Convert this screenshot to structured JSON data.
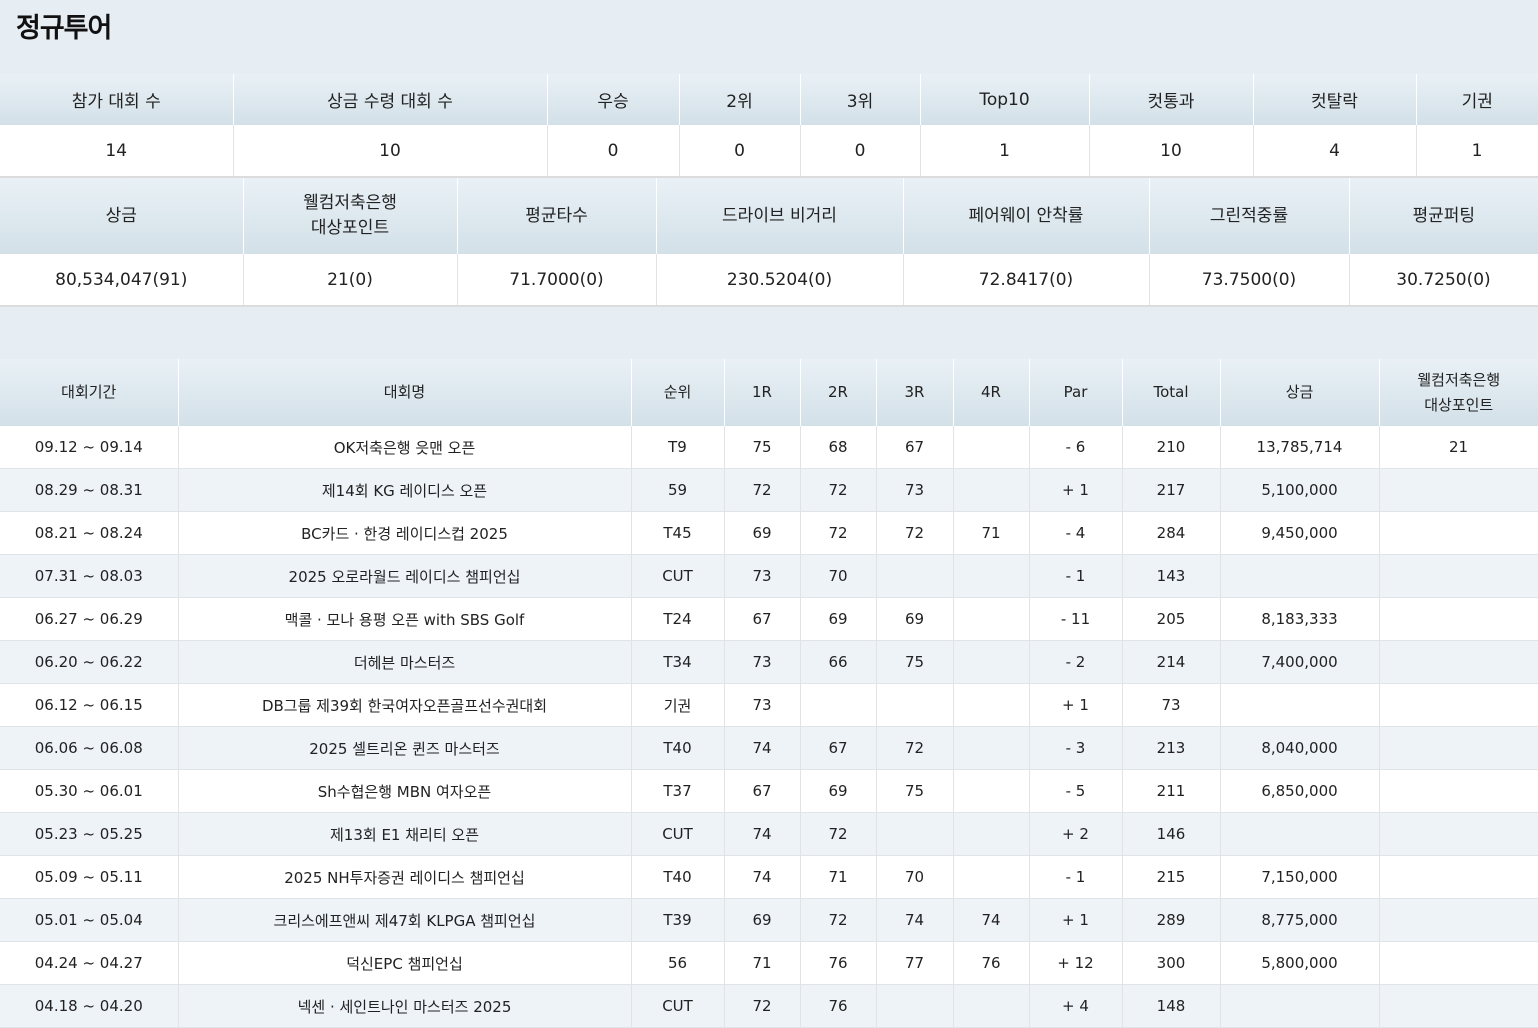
{
  "page_title": "정규투어",
  "summary": {
    "headers": [
      "참가 대회 수",
      "상금 수령 대회 수",
      "우승",
      "2위",
      "3위",
      "Top10",
      "컷통과",
      "컷탈락",
      "기권"
    ],
    "values": [
      "14",
      "10",
      "0",
      "0",
      "0",
      "1",
      "10",
      "4",
      "1"
    ]
  },
  "stats": {
    "headers": [
      "상금",
      "웰컴저축은행\n대상포인트",
      "평균타수",
      "드라이브 비거리",
      "페어웨이 안착률",
      "그린적중률",
      "평균퍼팅"
    ],
    "values": [
      "80,534,047(91)",
      "21(0)",
      "71.7000(0)",
      "230.5204(0)",
      "72.8417(0)",
      "73.7500(0)",
      "30.7250(0)"
    ]
  },
  "results": {
    "headers": [
      "대회기간",
      "대회명",
      "순위",
      "1R",
      "2R",
      "3R",
      "4R",
      "Par",
      "Total",
      "상금",
      "웰컴저축은행\n대상포인트"
    ],
    "rows": [
      [
        "09.12 ~ 09.14",
        "OK저축은행 읏맨 오픈",
        "T9",
        "75",
        "68",
        "67",
        "",
        "- 6",
        "210",
        "13,785,714",
        "21"
      ],
      [
        "08.29 ~ 08.31",
        "제14회 KG 레이디스 오픈",
        "59",
        "72",
        "72",
        "73",
        "",
        "+ 1",
        "217",
        "5,100,000",
        ""
      ],
      [
        "08.21 ~ 08.24",
        "BC카드 · 한경 레이디스컵 2025",
        "T45",
        "69",
        "72",
        "72",
        "71",
        "- 4",
        "284",
        "9,450,000",
        ""
      ],
      [
        "07.31 ~ 08.03",
        "2025 오로라월드 레이디스 챔피언십",
        "CUT",
        "73",
        "70",
        "",
        "",
        "- 1",
        "143",
        "",
        ""
      ],
      [
        "06.27 ~ 06.29",
        "맥콜 · 모나 용평 오픈 with SBS Golf",
        "T24",
        "67",
        "69",
        "69",
        "",
        "- 11",
        "205",
        "8,183,333",
        ""
      ],
      [
        "06.20 ~ 06.22",
        "더헤븐 마스터즈",
        "T34",
        "73",
        "66",
        "75",
        "",
        "- 2",
        "214",
        "7,400,000",
        ""
      ],
      [
        "06.12 ~ 06.15",
        "DB그룹 제39회 한국여자오픈골프선수권대회",
        "기권",
        "73",
        "",
        "",
        "",
        "+ 1",
        "73",
        "",
        ""
      ],
      [
        "06.06 ~ 06.08",
        "2025 셀트리온 퀸즈 마스터즈",
        "T40",
        "74",
        "67",
        "72",
        "",
        "- 3",
        "213",
        "8,040,000",
        ""
      ],
      [
        "05.30 ~ 06.01",
        "Sh수협은행 MBN 여자오픈",
        "T37",
        "67",
        "69",
        "75",
        "",
        "- 5",
        "211",
        "6,850,000",
        ""
      ],
      [
        "05.23 ~ 05.25",
        "제13회 E1 채리티 오픈",
        "CUT",
        "74",
        "72",
        "",
        "",
        "+ 2",
        "146",
        "",
        ""
      ],
      [
        "05.09 ~ 05.11",
        "2025 NH투자증권 레이디스 챔피언십",
        "T40",
        "74",
        "71",
        "70",
        "",
        "- 1",
        "215",
        "7,150,000",
        ""
      ],
      [
        "05.01 ~ 05.04",
        "크리스에프앤씨 제47회 KLPGA 챔피언십",
        "T39",
        "69",
        "72",
        "74",
        "74",
        "+ 1",
        "289",
        "8,775,000",
        ""
      ],
      [
        "04.24 ~ 04.27",
        "덕신EPC 챔피언십",
        "56",
        "71",
        "76",
        "77",
        "76",
        "+ 12",
        "300",
        "5,800,000",
        ""
      ],
      [
        "04.18 ~ 04.20",
        "넥센 · 세인트나인 마스터즈 2025",
        "CUT",
        "72",
        "76",
        "",
        "",
        "+ 4",
        "148",
        "",
        ""
      ]
    ]
  }
}
